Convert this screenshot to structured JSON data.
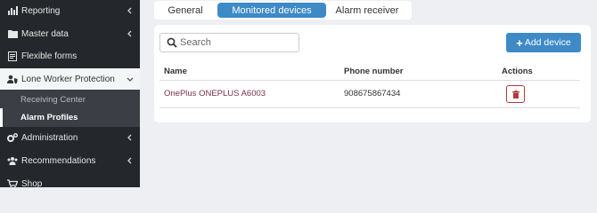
{
  "sidebar": {
    "items": [
      {
        "label": "Reporting",
        "icon": "bar-chart-icon"
      },
      {
        "label": "Master data",
        "icon": "folder-icon"
      },
      {
        "label": "Flexible forms",
        "icon": "form-icon"
      },
      {
        "label": "Lone Worker Protection",
        "icon": "user-shield-icon"
      },
      {
        "label": "Administration",
        "icon": "gears-icon"
      },
      {
        "label": "Recommendations",
        "icon": "users-icon"
      },
      {
        "label": "Shop",
        "icon": "cart-icon"
      }
    ],
    "sub_items": [
      {
        "label": "Receiving Center"
      },
      {
        "label": "Alarm Profiles"
      }
    ]
  },
  "tabs": [
    {
      "label": "General"
    },
    {
      "label": "Monitored devices"
    },
    {
      "label": "Alarm receiver"
    }
  ],
  "search": {
    "placeholder": "Search"
  },
  "add_button": {
    "label": "Add device"
  },
  "table": {
    "headers": {
      "name": "Name",
      "phone": "Phone number",
      "actions": "Actions"
    },
    "rows": [
      {
        "name": "OnePlus ONEPLUS A6003",
        "phone": "908675867434"
      }
    ]
  },
  "colors": {
    "sidebar_bg": "#24272b",
    "accent": "#3d8ac6",
    "danger": "#b23a3a",
    "link": "#7a2f4e"
  }
}
